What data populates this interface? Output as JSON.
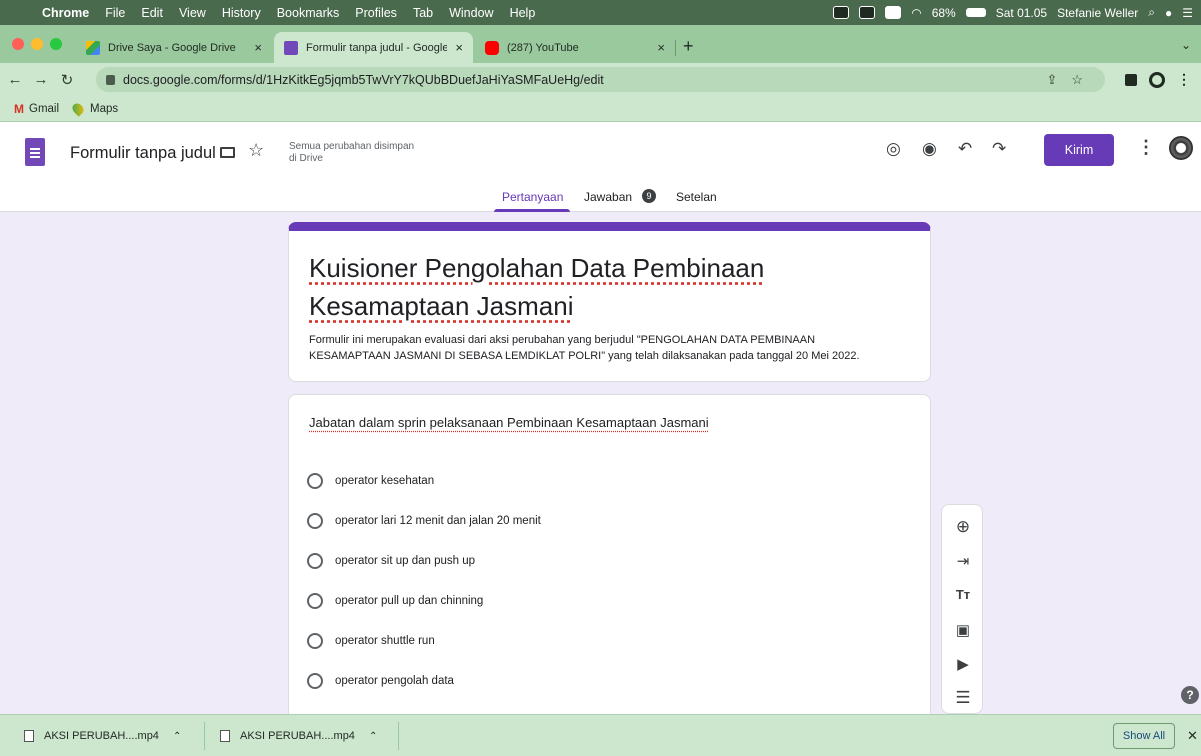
{
  "macos_menubar": {
    "app_name": "Chrome",
    "menus": [
      "File",
      "Edit",
      "View",
      "History",
      "Bookmarks",
      "Profiles",
      "Tab",
      "Window",
      "Help"
    ],
    "battery": "68%",
    "clock": "Sat 01.05",
    "user": "Stefanie Weller"
  },
  "browser": {
    "tabs": [
      {
        "title": "Drive Saya - Google Drive",
        "icon": "google-drive-icon",
        "active": false
      },
      {
        "title": "Formulir tanpa judul - Google F",
        "icon": "google-forms-icon",
        "active": true
      },
      {
        "title": "(287) YouTube",
        "icon": "youtube-icon",
        "active": false
      }
    ],
    "url": "docs.google.com/forms/d/1HzKitkEg5jqmb5TwVrY7kQUbBDuefJaHiYaSMFaUeHg/edit",
    "bookmarks": [
      {
        "label": "Gmail",
        "icon": "gmail-icon"
      },
      {
        "label": "Maps",
        "icon": "maps-icon"
      }
    ]
  },
  "forms_header": {
    "doc_title": "Formulir tanpa judul",
    "save_status_line1": "Semua perubahan disimpan",
    "save_status_line2": "di Drive",
    "send_label": "Kirim",
    "tabs": [
      {
        "label": "Pertanyaan",
        "active": true
      },
      {
        "label": "Jawaban",
        "active": false,
        "badge": "9"
      },
      {
        "label": "Setelan",
        "active": false
      }
    ],
    "accent_color": "#673ab7"
  },
  "form": {
    "title_line1": "Kuisioner Pengolahan Data Pembinaan",
    "title_line2": "Kesamaptaan Jasmani",
    "description_line1": "Formulir ini merupakan evaluasi dari aksi perubahan yang berjudul \"PENGOLAHAN DATA PEMBINAAN",
    "description_line2": "KESAMAPTAAN JASMANI DI SEBASA LEMDIKLAT POLRI\" yang telah dilaksanakan pada tanggal 20 Mei 2022.",
    "question": {
      "text": "Jabatan dalam sprin pelaksanaan Pembinaan Kesamaptaan Jasmani",
      "options": [
        "operator kesehatan",
        "operator lari 12 menit dan jalan 20 menit",
        "operator sit up dan push up",
        "operator pull up dan chinning",
        "operator shuttle run",
        "operator pengolah data"
      ]
    }
  },
  "toolbar_icons": [
    "add-question-icon",
    "import-questions-icon",
    "add-title-icon",
    "add-image-icon",
    "add-video-icon",
    "add-section-icon"
  ],
  "downloads": {
    "items": [
      "AKSI PERUBAH....mp4",
      "AKSI PERUBAH....mp4"
    ],
    "show_all_label": "Show All"
  }
}
